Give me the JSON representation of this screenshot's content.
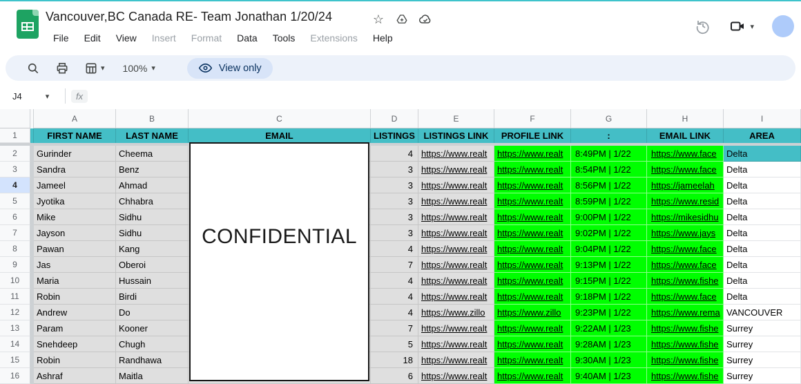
{
  "titlebar": {
    "doc_title": "Vancouver,BC Canada RE- Team Jonathan 1/20/24",
    "menus": [
      {
        "label": "File",
        "enabled": true
      },
      {
        "label": "Edit",
        "enabled": true
      },
      {
        "label": "View",
        "enabled": true
      },
      {
        "label": "Insert",
        "enabled": false
      },
      {
        "label": "Format",
        "enabled": false
      },
      {
        "label": "Data",
        "enabled": true
      },
      {
        "label": "Tools",
        "enabled": true
      },
      {
        "label": "Extensions",
        "enabled": false
      },
      {
        "label": "Help",
        "enabled": true
      }
    ],
    "icons": {
      "star": "star-icon",
      "drive_add": "add-to-drive-icon",
      "cloud": "cloud-saved-icon",
      "history": "version-history-icon",
      "meet": "video-call-icon",
      "avatar": "avatar"
    }
  },
  "toolbar": {
    "zoom_level": "100%",
    "view_only_label": "View only",
    "icons": {
      "search": "search-icon",
      "print": "print-icon",
      "filter_views": "filter-views-icon",
      "eye": "eye-icon"
    }
  },
  "formula_bar": {
    "name_box": "J4",
    "fx_label": "fx",
    "formula_value": ""
  },
  "sheet": {
    "column_letters": [
      "A",
      "B",
      "C",
      "D",
      "E",
      "F",
      "G",
      "H",
      "I"
    ],
    "header_row": [
      "FIRST NAME",
      "LAST NAME",
      "EMAIL",
      "LISTINGS",
      "LISTINGS LINK",
      "PROFILE LINK",
      ":",
      "EMAIL LINK",
      "AREA"
    ],
    "header_bg": "#44bec6",
    "link_color": "#1155cc",
    "green_bg": "#00ff00",
    "rows": [
      {
        "n": 2,
        "first": "Gurinder",
        "last": "Cheema",
        "listings": "4",
        "listings_link": "https://www.realt",
        "profile_link": "https://www.realt",
        "time": "8:49PM | 1/22",
        "email_link": "https://www.face",
        "area": "Delta",
        "area_teal": true,
        "selected": false
      },
      {
        "n": 3,
        "first": "Sandra",
        "last": "Benz",
        "listings": "3",
        "listings_link": "https://www.realt",
        "profile_link": "https://www.realt",
        "time": "8:54PM | 1/22",
        "email_link": "https://www.face",
        "area": "Delta",
        "area_teal": false,
        "selected": false
      },
      {
        "n": 4,
        "first": "Jameel",
        "last": "Ahmad",
        "listings": "3",
        "listings_link": "https://www.realt",
        "profile_link": "https://www.realt",
        "time": "8:56PM | 1/22",
        "email_link": "https://jameelah",
        "area": "Delta",
        "area_teal": false,
        "selected": true
      },
      {
        "n": 5,
        "first": "Jyotika",
        "last": "Chhabra",
        "listings": "3",
        "listings_link": "https://www.realt",
        "profile_link": "https://www.realt",
        "time": "8:59PM | 1/22",
        "email_link": "https://www.resid",
        "area": "Delta",
        "area_teal": false,
        "selected": false
      },
      {
        "n": 6,
        "first": "Mike",
        "last": "Sidhu",
        "listings": "3",
        "listings_link": "https://www.realt",
        "profile_link": "https://www.realt",
        "time": "9:00PM | 1/22",
        "email_link": "https://mikesidhu",
        "area": "Delta",
        "area_teal": false,
        "selected": false
      },
      {
        "n": 7,
        "first": "Jayson",
        "last": "Sidhu",
        "listings": "3",
        "listings_link": "https://www.realt",
        "profile_link": "https://www.realt",
        "time": "9:02PM | 1/22",
        "email_link": "https://www.jays",
        "area": "Delta",
        "area_teal": false,
        "selected": false
      },
      {
        "n": 8,
        "first": "Pawan",
        "last": "Kang",
        "listings": "4",
        "listings_link": "https://www.realt",
        "profile_link": "https://www.realt",
        "time": "9:04PM | 1/22",
        "email_link": "https://www.face",
        "area": "Delta",
        "area_teal": false,
        "selected": false
      },
      {
        "n": 9,
        "first": "Jas",
        "last": "Oberoi",
        "listings": "7",
        "listings_link": "https://www.realt",
        "profile_link": "https://www.realt",
        "time": "9:13PM | 1/22",
        "email_link": "https://www.face",
        "area": "Delta",
        "area_teal": false,
        "selected": false
      },
      {
        "n": 10,
        "first": "Maria",
        "last": "Hussain",
        "listings": "4",
        "listings_link": "https://www.realt",
        "profile_link": "https://www.realt",
        "time": "9:15PM | 1/22",
        "email_link": "https://www.fishe",
        "area": "Delta",
        "area_teal": false,
        "selected": false
      },
      {
        "n": 11,
        "first": "Robin",
        "last": "Birdi",
        "listings": "4",
        "listings_link": "https://www.realt",
        "profile_link": "https://www.realt",
        "time": "9:18PM | 1/22",
        "email_link": "https://www.face",
        "area": "Delta",
        "area_teal": false,
        "selected": false
      },
      {
        "n": 12,
        "first": "Andrew",
        "last": "Do",
        "listings": "4",
        "listings_link": "https://www.zillo",
        "profile_link": "https://www.zillo",
        "time": "9:23PM | 1/22",
        "email_link": "https://www.rema",
        "area": "VANCOUVER",
        "area_teal": false,
        "selected": false
      },
      {
        "n": 13,
        "first": "Param",
        "last": "Kooner",
        "listings": "7",
        "listings_link": "https://www.realt",
        "profile_link": "https://www.realt",
        "time": "9:22AM | 1/23",
        "email_link": "https://www.fishe",
        "area": "Surrey",
        "area_teal": false,
        "selected": false
      },
      {
        "n": 14,
        "first": "Snehdeep",
        "last": "Chugh",
        "listings": "5",
        "listings_link": "https://www.realt",
        "profile_link": "https://www.realt",
        "time": "9:28AM | 1/23",
        "email_link": "https://www.fishe",
        "area": "Surrey",
        "area_teal": false,
        "selected": false
      },
      {
        "n": 15,
        "first": "Robin",
        "last": "Randhawa",
        "listings": "18",
        "listings_link": "https://www.realt",
        "profile_link": "https://www.realt",
        "time": "9:30AM | 1/23",
        "email_link": "https://www.fishe",
        "area": "Surrey",
        "area_teal": false,
        "selected": false
      },
      {
        "n": 16,
        "first": "Ashraf",
        "last": "Maitla",
        "listings": "6",
        "listings_link": "https://www.realt",
        "profile_link": "https://www.realt",
        "time": "9:40AM | 1/23",
        "email_link": "https://www.fishe",
        "area": "Surrey",
        "area_teal": false,
        "selected": false
      }
    ]
  },
  "overlay": {
    "confidential_label": "CONFIDENTIAL"
  }
}
